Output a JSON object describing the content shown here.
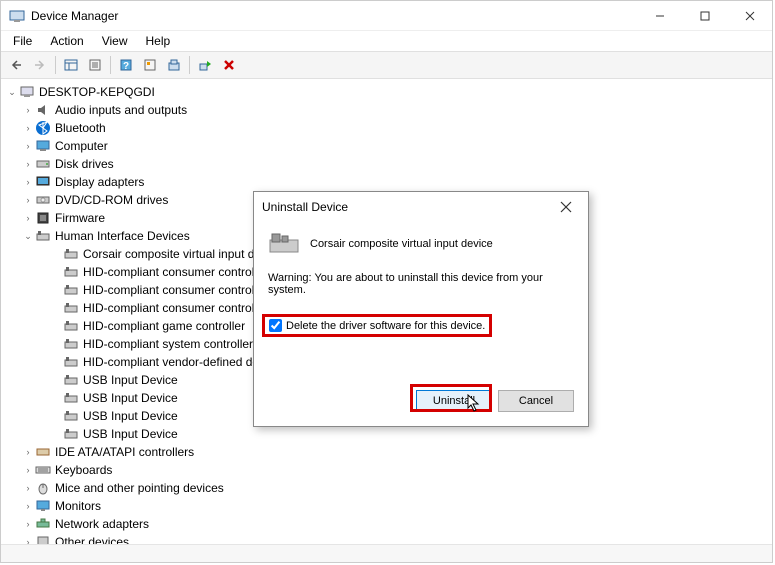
{
  "titlebar": {
    "title": "Device Manager"
  },
  "menubar": {
    "file": "File",
    "action": "Action",
    "view": "View",
    "help": "Help"
  },
  "tree": {
    "root": "DESKTOP-KEPQGDI",
    "audio": "Audio inputs and outputs",
    "bluetooth": "Bluetooth",
    "computer": "Computer",
    "disk": "Disk drives",
    "display": "Display adapters",
    "dvd": "DVD/CD-ROM drives",
    "firmware": "Firmware",
    "hid": "Human Interface Devices",
    "hid_items": [
      "Corsair composite virtual input device",
      "HID-compliant consumer control device",
      "HID-compliant consumer control device",
      "HID-compliant consumer control device",
      "HID-compliant game controller",
      "HID-compliant system controller",
      "HID-compliant vendor-defined device",
      "USB Input Device",
      "USB Input Device",
      "USB Input Device",
      "USB Input Device"
    ],
    "ide": "IDE ATA/ATAPI controllers",
    "keyboards": "Keyboards",
    "mice": "Mice and other pointing devices",
    "monitors": "Monitors",
    "network": "Network adapters",
    "other": "Other devices"
  },
  "dialog": {
    "title": "Uninstall Device",
    "device": "Corsair composite virtual input device",
    "warning": "Warning: You are about to uninstall this device from your system.",
    "checkbox": "Delete the driver software for this device.",
    "uninstall": "Uninstall",
    "cancel": "Cancel"
  }
}
